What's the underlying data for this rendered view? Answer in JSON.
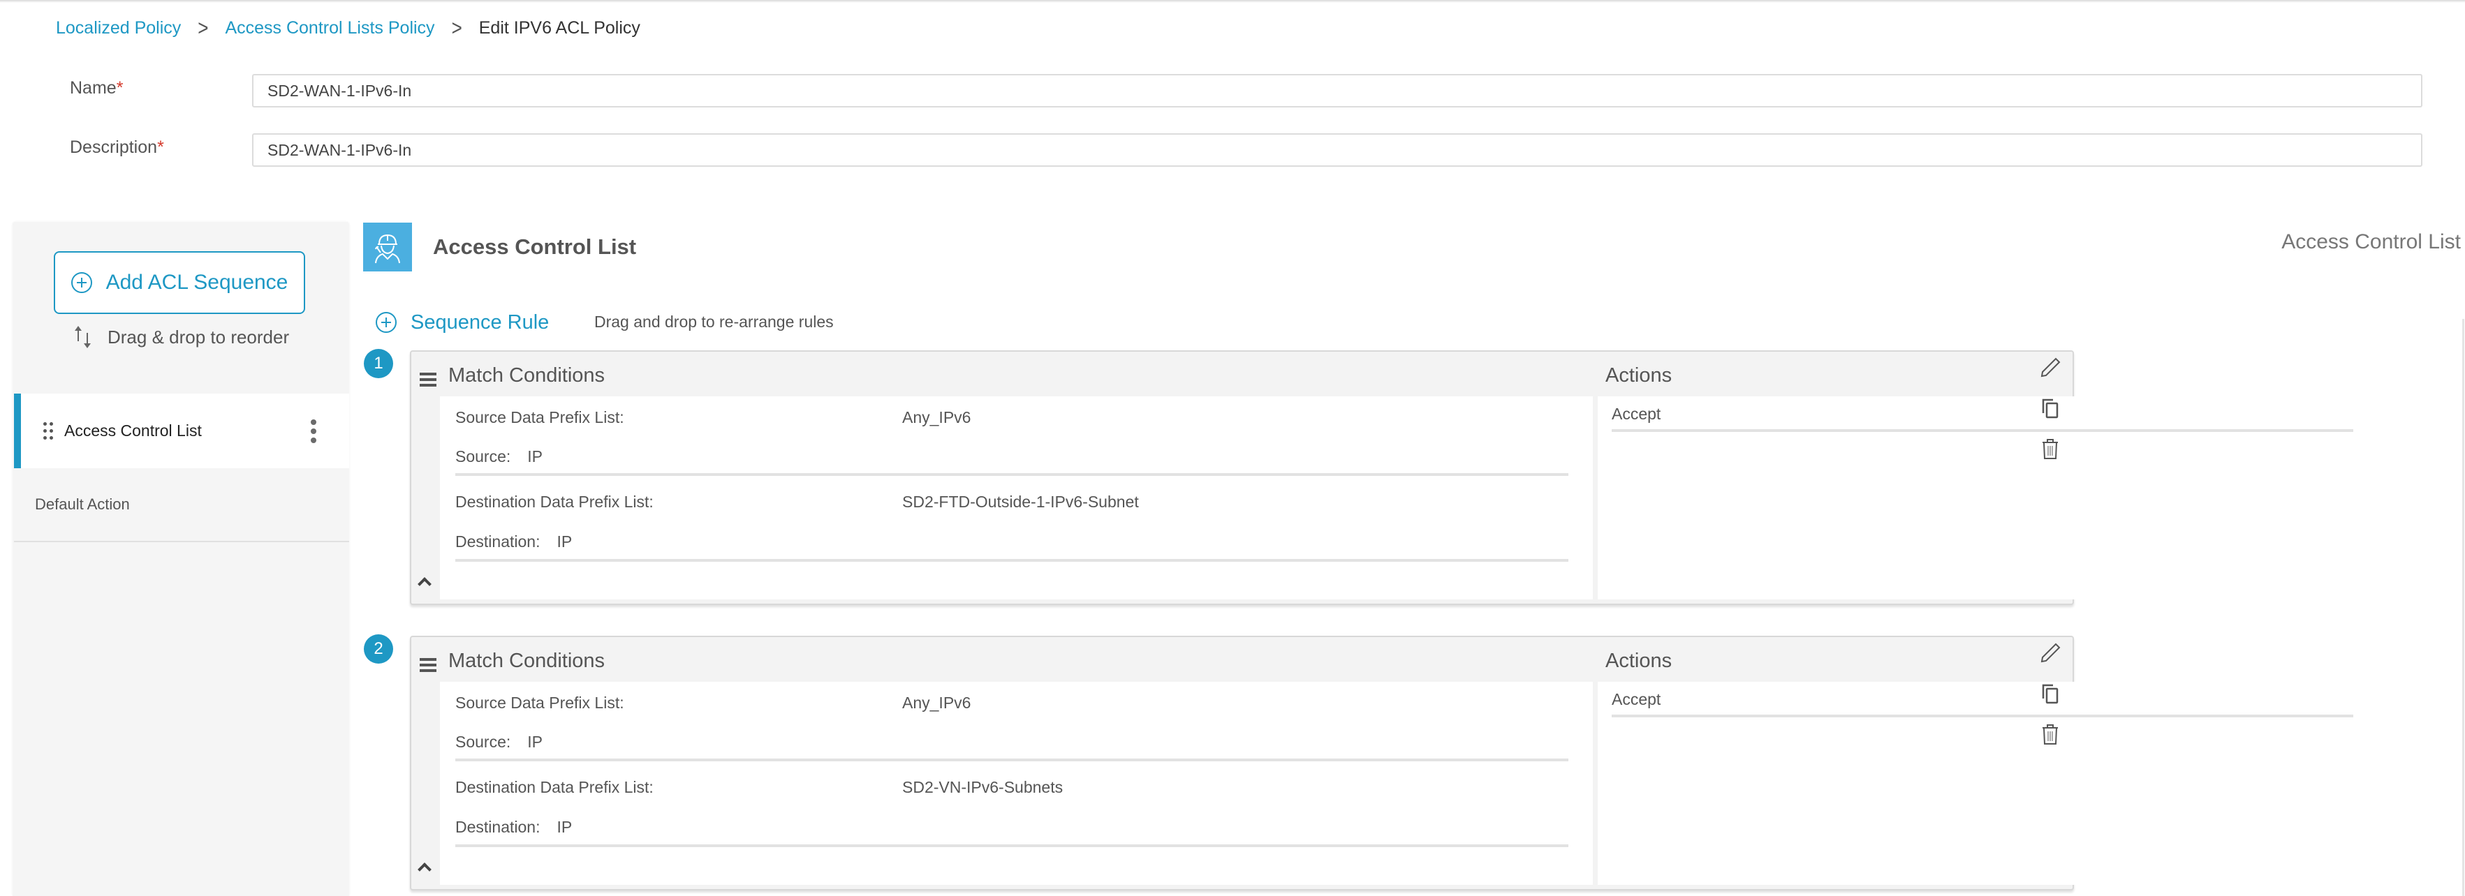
{
  "breadcrumb": {
    "items": [
      "Localized Policy",
      "Access Control Lists Policy"
    ],
    "current": "Edit IPV6 ACL Policy"
  },
  "form": {
    "name_label": "Name",
    "name_value": "SD2-WAN-1-IPv6-In",
    "description_label": "Description",
    "description_value": "SD2-WAN-1-IPv6-In",
    "required_mark": "*"
  },
  "sidebar": {
    "add_button_label": "Add ACL Sequence",
    "reorder_hint": "Drag & drop to reorder",
    "items": [
      {
        "label": "Access Control List",
        "active": true
      },
      {
        "label": "Default Action",
        "active": false
      }
    ]
  },
  "main": {
    "title": "Access Control List",
    "right_title": "Access Control List",
    "sequence_rule_label": "Sequence Rule",
    "rearrange_hint": "Drag and drop to re-arrange rules",
    "match_conditions_label": "Match Conditions",
    "actions_label": "Actions",
    "rules": [
      {
        "number": "1",
        "source_prefix_label": "Source Data Prefix List:",
        "source_prefix_value": "Any_IPv6",
        "source_label": "Source:",
        "source_value": "IP",
        "dest_prefix_label": "Destination Data Prefix List:",
        "dest_prefix_value": "SD2-FTD-Outside-1-IPv6-Subnet",
        "dest_label": "Destination:",
        "dest_value": "IP",
        "action": "Accept"
      },
      {
        "number": "2",
        "source_prefix_label": "Source Data Prefix List:",
        "source_prefix_value": "Any_IPv6",
        "source_label": "Source:",
        "source_value": "IP",
        "dest_prefix_label": "Destination Data Prefix List:",
        "dest_prefix_value": "SD2-VN-IPv6-Subnets",
        "dest_label": "Destination:",
        "dest_value": "IP",
        "action": "Accept"
      }
    ]
  },
  "icons": {
    "header": "worker-hardhat-icon",
    "add": "plus-circle-icon",
    "reorder": "sort-arrows-icon",
    "grip": "drag-grip-icon",
    "more": "kebab-menu-icon",
    "drag_rule": "hamburger-icon",
    "collapse": "chevron-up-icon",
    "edit": "pencil-icon",
    "copy": "copy-icon",
    "delete": "trash-icon"
  },
  "colors": {
    "accent": "#1e98c4",
    "header_icon_bg": "#4bafe0",
    "required": "#d43a2c",
    "sidebar_bg": "#f5f5f5",
    "card_bg": "#f3f3f3"
  }
}
